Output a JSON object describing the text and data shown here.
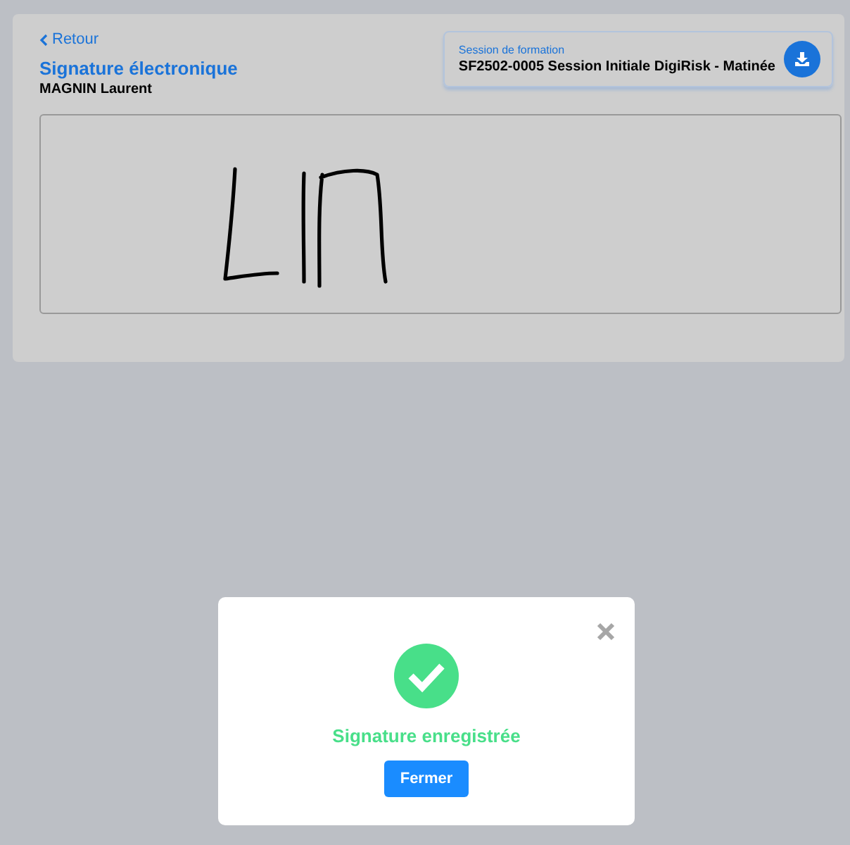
{
  "back_link": {
    "label": "Retour"
  },
  "page_title": "Signature électronique",
  "person_name": "MAGNIN Laurent",
  "session": {
    "caption": "Session de formation",
    "value": "SF2502-0005 Session Initiale DigiRisk - Matinée"
  },
  "dialog": {
    "message": "Signature enregistrée",
    "button": "Fermer"
  }
}
